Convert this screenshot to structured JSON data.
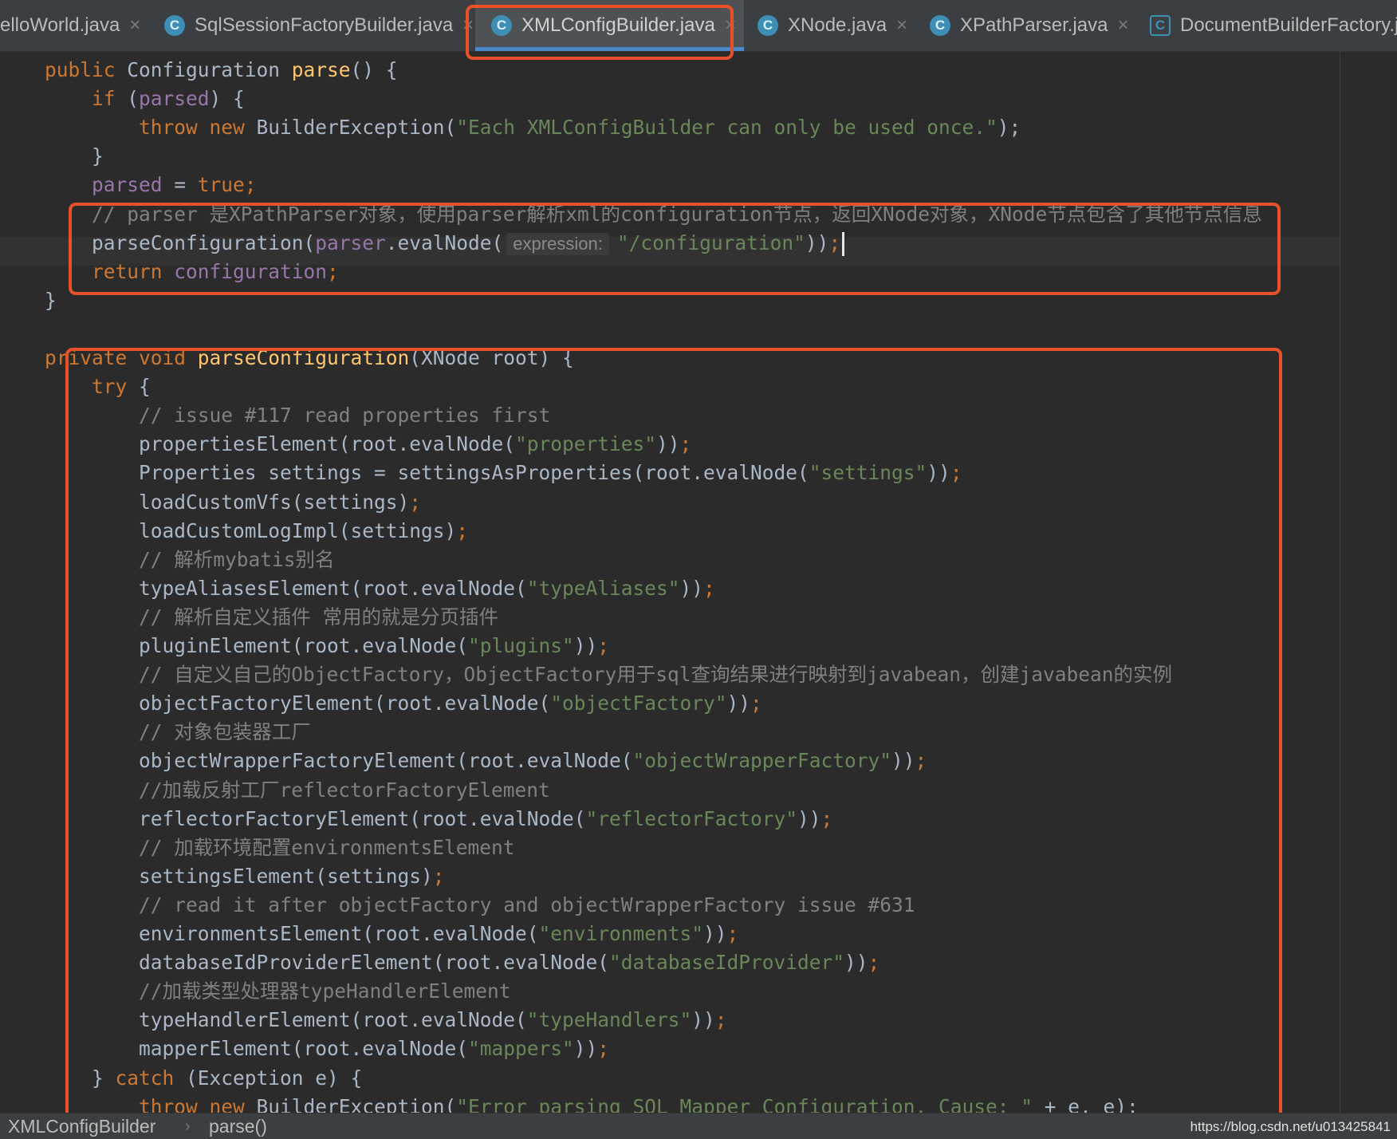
{
  "tabs": [
    {
      "label": "elloWorld.java",
      "active": false,
      "icon": "class-icon"
    },
    {
      "label": "SqlSessionFactoryBuilder.java",
      "active": false,
      "icon": "class-icon"
    },
    {
      "label": "XMLConfigBuilder.java",
      "active": true,
      "icon": "class-icon"
    },
    {
      "label": "XNode.java",
      "active": false,
      "icon": "class-icon"
    },
    {
      "label": "XPathParser.java",
      "active": false,
      "icon": "class-icon"
    },
    {
      "label": "DocumentBuilderFactory.ja",
      "active": false,
      "icon": "abstract-class-icon"
    }
  ],
  "tab_close_glyph": "×",
  "tab_icon_letter": "C",
  "editor": {
    "parameter_hint": "expression:",
    "lines": [
      [
        [
          "kw",
          "public "
        ],
        [
          "pl",
          "Configuration "
        ],
        [
          "fn",
          "parse"
        ],
        [
          "pl",
          "() {"
        ]
      ],
      [
        [
          "kw",
          "    if "
        ],
        [
          "pl",
          "("
        ],
        [
          "fld",
          "parsed"
        ],
        [
          "pl",
          ") {"
        ]
      ],
      [
        [
          "kw",
          "        throw new "
        ],
        [
          "pl",
          "BuilderException("
        ],
        [
          "str",
          "\"Each XMLConfigBuilder can only be used once.\""
        ],
        [
          "pl",
          ");"
        ]
      ],
      [
        [
          "pl",
          "    }"
        ]
      ],
      [
        [
          "fld",
          "    parsed "
        ],
        [
          "pl",
          "= "
        ],
        [
          "kw",
          "true;"
        ]
      ],
      [
        [
          "cmt",
          "    // parser 是XPathParser对象，使用parser解析xml的configuration节点，返回XNode对象，XNode节点包含了其他节点信息"
        ]
      ],
      [
        [
          "pl",
          "    parseConfiguration("
        ],
        [
          "fld",
          "parser"
        ],
        [
          "pl",
          ".evalNode("
        ],
        [
          "hint",
          ""
        ],
        [
          "str",
          "\"/configuration\""
        ],
        [
          "pl",
          "))"
        ],
        [
          "kw",
          ";"
        ],
        [
          "cursor",
          ""
        ]
      ],
      [
        [
          "kw",
          "    return "
        ],
        [
          "fld",
          "configuration"
        ],
        [
          "kw",
          ";"
        ]
      ],
      [
        [
          "pl",
          "}"
        ]
      ],
      [
        [
          "pl",
          ""
        ]
      ],
      [
        [
          "kw",
          "private void "
        ],
        [
          "fn",
          "parseConfiguration"
        ],
        [
          "pl",
          "(XNode root) {"
        ]
      ],
      [
        [
          "kw",
          "    try "
        ],
        [
          "pl",
          "{"
        ]
      ],
      [
        [
          "cmt",
          "        // issue #117 read properties first"
        ]
      ],
      [
        [
          "pl",
          "        propertiesElement(root.evalNode("
        ],
        [
          "str",
          "\"properties\""
        ],
        [
          "pl",
          "))"
        ],
        [
          "kw",
          ";"
        ]
      ],
      [
        [
          "pl",
          "        Properties settings = settingsAsProperties(root.evalNode("
        ],
        [
          "str",
          "\"settings\""
        ],
        [
          "pl",
          "))"
        ],
        [
          "kw",
          ";"
        ]
      ],
      [
        [
          "pl",
          "        loadCustomVfs(settings)"
        ],
        [
          "kw",
          ";"
        ]
      ],
      [
        [
          "pl",
          "        loadCustomLogImpl(settings)"
        ],
        [
          "kw",
          ";"
        ]
      ],
      [
        [
          "cmt",
          "        // 解析mybatis别名"
        ]
      ],
      [
        [
          "pl",
          "        typeAliasesElement(root.evalNode("
        ],
        [
          "str",
          "\"typeAliases\""
        ],
        [
          "pl",
          "))"
        ],
        [
          "kw",
          ";"
        ]
      ],
      [
        [
          "cmt",
          "        // 解析自定义插件 常用的就是分页插件"
        ]
      ],
      [
        [
          "pl",
          "        pluginElement(root.evalNode("
        ],
        [
          "str",
          "\"plugins\""
        ],
        [
          "pl",
          "))"
        ],
        [
          "kw",
          ";"
        ]
      ],
      [
        [
          "cmt",
          "        // 自定义自己的ObjectFactory，ObjectFactory用于sql查询结果进行映射到javabean，创建javabean的实例"
        ]
      ],
      [
        [
          "pl",
          "        objectFactoryElement(root.evalNode("
        ],
        [
          "str",
          "\"objectFactory\""
        ],
        [
          "pl",
          "))"
        ],
        [
          "kw",
          ";"
        ]
      ],
      [
        [
          "cmt",
          "        // 对象包装器工厂"
        ]
      ],
      [
        [
          "pl",
          "        objectWrapperFactoryElement(root.evalNode("
        ],
        [
          "str",
          "\"objectWrapperFactory\""
        ],
        [
          "pl",
          "))"
        ],
        [
          "kw",
          ";"
        ]
      ],
      [
        [
          "cmt",
          "        //加载反射工厂reflectorFactoryElement"
        ]
      ],
      [
        [
          "pl",
          "        reflectorFactoryElement(root.evalNode("
        ],
        [
          "str",
          "\"reflectorFactory\""
        ],
        [
          "pl",
          "))"
        ],
        [
          "kw",
          ";"
        ]
      ],
      [
        [
          "cmt",
          "        // 加载环境配置environmentsElement"
        ]
      ],
      [
        [
          "pl",
          "        settingsElement(settings)"
        ],
        [
          "kw",
          ";"
        ]
      ],
      [
        [
          "cmt",
          "        // read it after objectFactory and objectWrapperFactory issue #631"
        ]
      ],
      [
        [
          "pl",
          "        environmentsElement(root.evalNode("
        ],
        [
          "str",
          "\"environments\""
        ],
        [
          "pl",
          "))"
        ],
        [
          "kw",
          ";"
        ]
      ],
      [
        [
          "pl",
          "        databaseIdProviderElement(root.evalNode("
        ],
        [
          "str",
          "\"databaseIdProvider\""
        ],
        [
          "pl",
          "))"
        ],
        [
          "kw",
          ";"
        ]
      ],
      [
        [
          "cmt",
          "        //加载类型处理器typeHandlerElement"
        ]
      ],
      [
        [
          "pl",
          "        typeHandlerElement(root.evalNode("
        ],
        [
          "str",
          "\"typeHandlers\""
        ],
        [
          "pl",
          "))"
        ],
        [
          "kw",
          ";"
        ]
      ],
      [
        [
          "pl",
          "        mapperElement(root.evalNode("
        ],
        [
          "str",
          "\"mappers\""
        ],
        [
          "pl",
          "))"
        ],
        [
          "kw",
          ";"
        ]
      ],
      [
        [
          "pl",
          "    } "
        ],
        [
          "kw",
          "catch "
        ],
        [
          "pl",
          "(Exception e) {"
        ]
      ],
      [
        [
          "kw",
          "        throw new "
        ],
        [
          "pl",
          "BuilderException("
        ],
        [
          "str",
          "\"Error parsing SQL Mapper Configuration. Cause: \""
        ],
        [
          "pl",
          " + e, e);"
        ]
      ]
    ]
  },
  "statusbar": {
    "crumbs": [
      "XMLConfigBuilder",
      "parse()"
    ],
    "separator": "›",
    "watermark": "https://blog.csdn.net/u013425841"
  },
  "colors": {
    "annotation": "#e8502a",
    "keyword": "#cc7832",
    "function": "#ffc66d",
    "field": "#9876aa",
    "string": "#6a8759",
    "comment": "#808080",
    "plain": "#a9b7c6"
  }
}
